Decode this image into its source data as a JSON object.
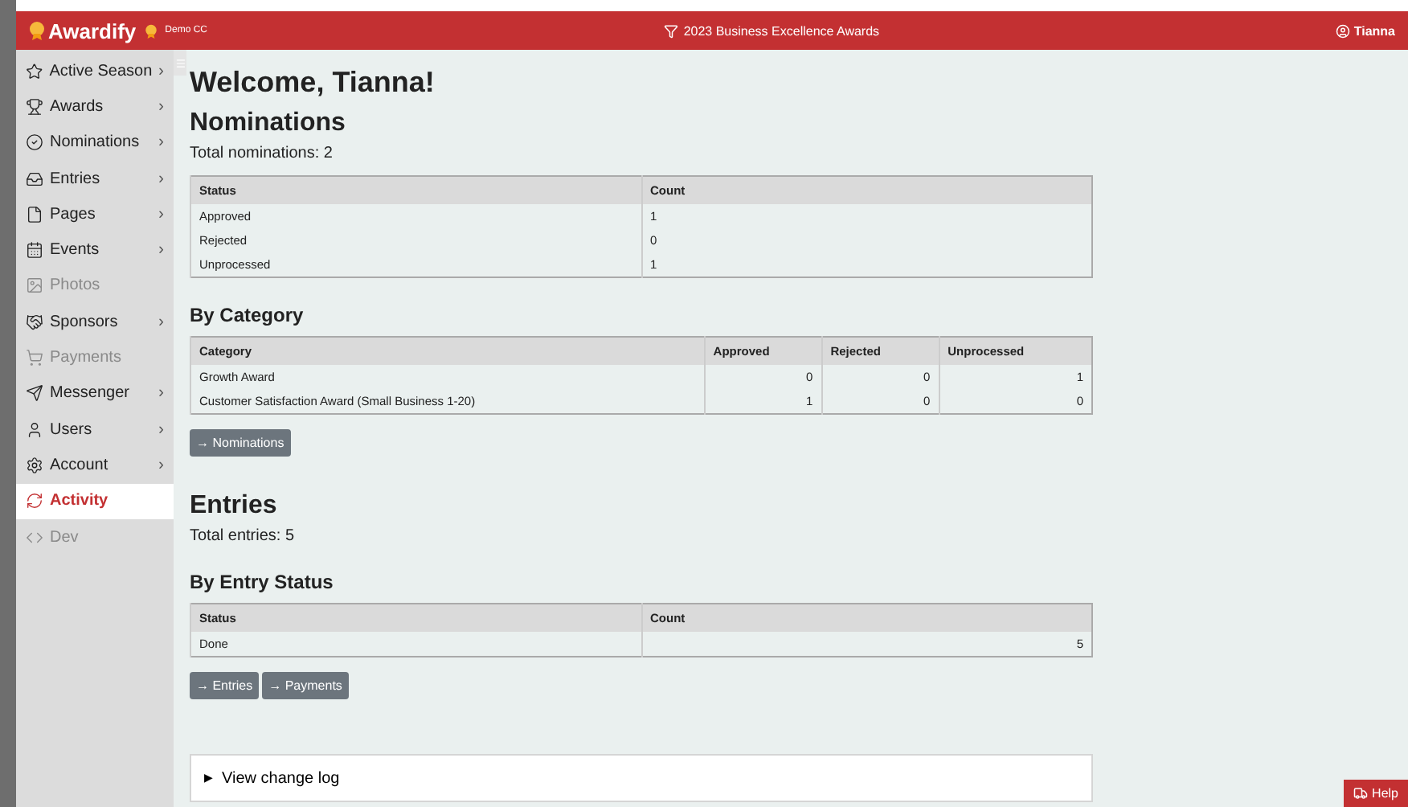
{
  "header": {
    "brand": "Awardify",
    "org": "Demo CC",
    "season": "2023 Business Excellence Awards",
    "user": "Tianna"
  },
  "sidebar": {
    "items": [
      {
        "label": "Active Season",
        "chevron": "›",
        "disabled": false,
        "selected": false
      },
      {
        "label": "Awards",
        "chevron": "›",
        "disabled": false,
        "selected": false
      },
      {
        "label": "Nominations",
        "chevron": "›",
        "disabled": false,
        "selected": false
      },
      {
        "label": "Entries",
        "chevron": "›",
        "disabled": false,
        "selected": false
      },
      {
        "label": "Pages",
        "chevron": "›",
        "disabled": false,
        "selected": false
      },
      {
        "label": "Events",
        "chevron": "›",
        "disabled": false,
        "selected": false
      },
      {
        "label": "Photos",
        "disabled": true,
        "selected": false
      },
      {
        "label": "Sponsors",
        "chevron": "›",
        "disabled": false,
        "selected": false
      },
      {
        "label": "Payments",
        "disabled": true,
        "selected": false
      },
      {
        "label": "Messenger",
        "chevron": "›",
        "disabled": false,
        "selected": false
      },
      {
        "label": "Users",
        "chevron": "›",
        "disabled": false,
        "selected": false
      },
      {
        "label": "Account",
        "chevron": "›",
        "disabled": false,
        "selected": false
      },
      {
        "label": "Activity",
        "disabled": false,
        "selected": true
      },
      {
        "label": "Dev",
        "disabled": true,
        "selected": false
      }
    ]
  },
  "main": {
    "welcome": "Welcome, Tianna!",
    "sections": [
      {
        "title": "Nominations",
        "total": "Total nominations: 2",
        "blocks": [
          {
            "kind": "table",
            "numbers_right": false,
            "columns": [
              "Status",
              "Count"
            ],
            "rows": [
              [
                "Approved",
                "1"
              ],
              [
                "Rejected",
                "0"
              ],
              [
                "Unprocessed",
                "1"
              ]
            ]
          },
          {
            "kind": "table",
            "title": "By Category",
            "numbers_right": true,
            "columns": [
              "Category",
              "Approved",
              "Rejected",
              "Unprocessed"
            ],
            "rows": [
              [
                "Growth Award",
                "0",
                "0",
                "1"
              ],
              [
                "Customer Satisfaction Award (Small Business 1-20)",
                "1",
                "0",
                "0"
              ]
            ]
          },
          {
            "kind": "buttons",
            "buttons": [
              "→ Nominations"
            ]
          }
        ]
      },
      {
        "title": "Entries",
        "total": "Total entries: 5",
        "blocks": [
          {
            "kind": "table",
            "title": "By Entry Status",
            "numbers_right": true,
            "columns": [
              "Status",
              "Count"
            ],
            "rows": [
              [
                "Done",
                "5"
              ]
            ]
          },
          {
            "kind": "buttons",
            "buttons": [
              "→ Entries",
              "→ Payments"
            ]
          }
        ]
      }
    ],
    "changelog": {
      "marker": "▶",
      "label": "View change log"
    }
  },
  "help": "Help"
}
